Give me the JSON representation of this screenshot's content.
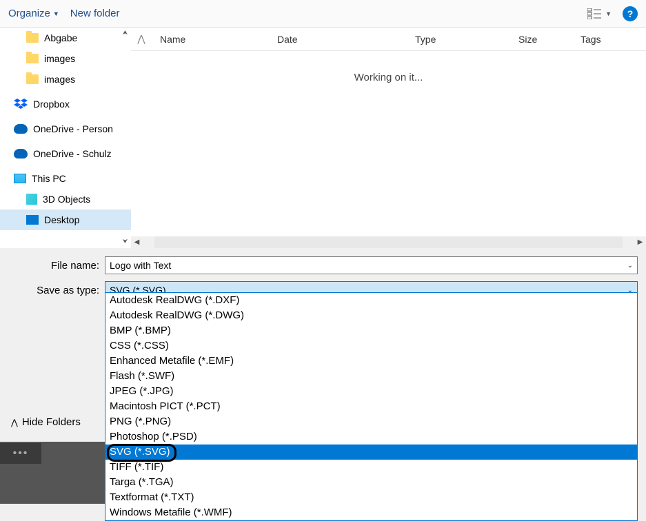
{
  "toolbar": {
    "organize": "Organize",
    "new_folder": "New folder"
  },
  "sidebar": {
    "items": [
      {
        "label": "Abgabe",
        "type": "folder"
      },
      {
        "label": "images",
        "type": "folder"
      },
      {
        "label": "images",
        "type": "folder"
      },
      {
        "label": "Dropbox",
        "type": "dropbox"
      },
      {
        "label": "OneDrive - Person",
        "type": "onedrive"
      },
      {
        "label": "OneDrive - Schulz",
        "type": "onedrive"
      },
      {
        "label": "This PC",
        "type": "pc"
      },
      {
        "label": "3D Objects",
        "type": "cube"
      },
      {
        "label": "Desktop",
        "type": "desktop"
      }
    ]
  },
  "columns": {
    "name": "Name",
    "date": "Date",
    "type": "Type",
    "size": "Size",
    "tags": "Tags"
  },
  "status": "Working on it...",
  "form": {
    "file_name_label": "File name:",
    "file_name_value": "Logo with Text",
    "save_type_label": "Save as type:",
    "save_type_value": "SVG (*.SVG)"
  },
  "dropdown_options": [
    "Autodesk RealDWG (*.DXF)",
    "Autodesk RealDWG (*.DWG)",
    "BMP (*.BMP)",
    "CSS (*.CSS)",
    "Enhanced Metafile (*.EMF)",
    "Flash (*.SWF)",
    "JPEG (*.JPG)",
    "Macintosh PICT (*.PCT)",
    "PNG (*.PNG)",
    "Photoshop (*.PSD)",
    "SVG (*.SVG)",
    "TIFF (*.TIF)",
    "Targa (*.TGA)",
    "Textformat (*.TXT)",
    "Windows Metafile (*.WMF)"
  ],
  "dropdown_selected_index": 10,
  "footer": {
    "hide_folders": "Hide Folders"
  }
}
